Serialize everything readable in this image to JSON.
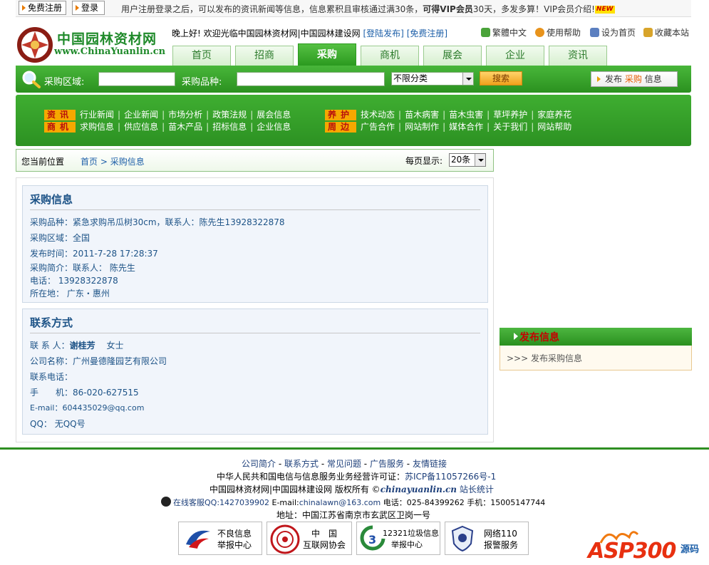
{
  "topbar": {
    "register_label": "免费注册",
    "login_label": "登录",
    "notice_text": "用户注册登录之后，可以发布的资讯新闻等信息，信息累积且审核通过满30条，",
    "notice_bold": "可得VIP会员",
    "notice_tail": "30天，多发多算！VIP会员介绍!",
    "new_badge": "NEW"
  },
  "logo": {
    "cn": "中国园林资材网",
    "en": "www.ChinaYuanlin.cn"
  },
  "header": {
    "welcome_prefix": "晚上好! 欢迎光临中国园林资材网|中国园林建设网",
    "login_publish": "[登陆发布]",
    "free_register": "[免费注册]",
    "quick_links": [
      {
        "label": "繁體中文",
        "icon": "refresh-icon",
        "color": "#4aa33a"
      },
      {
        "label": "使用帮助",
        "icon": "help-icon",
        "color": "#e8931c"
      },
      {
        "label": "设为首页",
        "icon": "home-icon",
        "color": "#5b7fc0"
      },
      {
        "label": "收藏本站",
        "icon": "folder-icon",
        "color": "#d8a42a"
      }
    ]
  },
  "tabs": [
    "首页",
    "招商",
    "采购",
    "商机",
    "展会",
    "企业",
    "资讯"
  ],
  "active_tab": "采购",
  "search": {
    "region_label": "采购区域:",
    "variety_label": "采购品种:",
    "category_value": "不限分类",
    "search_button": "搜索",
    "publish_prefix": "发布",
    "publish_highlight": "采购",
    "publish_suffix": "信息"
  },
  "nav": {
    "row1_cat1": "资讯",
    "row1_items1": [
      "行业新闻",
      "企业新闻",
      "市场分析",
      "政策法规",
      "展会信息"
    ],
    "row1_cat2": "养护",
    "row1_items2": [
      "技术动态",
      "苗木病害",
      "苗木虫害",
      "草坪养护",
      "家庭养花"
    ],
    "row2_cat1": "商机",
    "row2_items1": [
      "求购信息",
      "供应信息",
      "苗木产品",
      "招标信息",
      "企业信息"
    ],
    "row2_cat2": "周边",
    "row2_items2": [
      "广告合作",
      "网站制作",
      "媒体合作",
      "关于我们",
      "网站帮助"
    ]
  },
  "breadcrumb": {
    "label": "您当前位置",
    "home": "首页",
    "arrow": ">",
    "current": "采购信息",
    "per_page_label": "每页显示:",
    "per_page_value": "20条"
  },
  "purchase": {
    "title": "采购信息",
    "variety": "采购品种：紧急求购吊瓜树30cm，联系人：陈先生13928322878",
    "region": "采购区域：全国",
    "time": "发布时间：2011-7-28 17:28:37",
    "intro": "采购简介：联系人： 陈先生",
    "phone": "电话： 13928322878",
    "location": "所在地： 广东・惠州"
  },
  "contact": {
    "title": "联系方式",
    "person_label": "联 系 人：",
    "person_name": "谢桂芳",
    "person_title": "女士",
    "company": "公司名称：广州曼德隆园艺有限公司",
    "tel": "联系电话：",
    "mobile": "手　　机：86-020-627515",
    "email": "E-mail：604435029@qq.com",
    "qq": "QQ： 无QQ号"
  },
  "sidebar": {
    "title": "发布信息",
    "item": ">>> 发布采购信息"
  },
  "footer": {
    "links": [
      "公司简介",
      "联系方式",
      "常见问题",
      "广告服务",
      "友情链接"
    ],
    "license": "中华人民共和国电信与信息服务业务经营许可证：",
    "icp": "苏ICP备11057266号-1",
    "copyright": "中国园林资材网|中国园林建设网 版权所有 ©",
    "domain": "chinayuanlin.cn",
    "stats": "站长统计",
    "qq_service": "在线客服QQ:1427039902",
    "email_label": "E-mail:",
    "email": "chinalawn@163.com",
    "phone": "电话：025-84399262 手机：15005147744",
    "address": "地址：中国江苏省南京市玄武区卫岗一号",
    "badges": [
      {
        "line1": "不良信息",
        "line2": "举报中心"
      },
      {
        "line1": "中　国",
        "line2": "互联网协会"
      },
      {
        "line1": "12321垃圾信息",
        "line2": "举报中心"
      },
      {
        "line1": "网络110",
        "line2": "报警服务"
      }
    ],
    "watermark": "ASP300",
    "watermark_tail": "源码"
  }
}
